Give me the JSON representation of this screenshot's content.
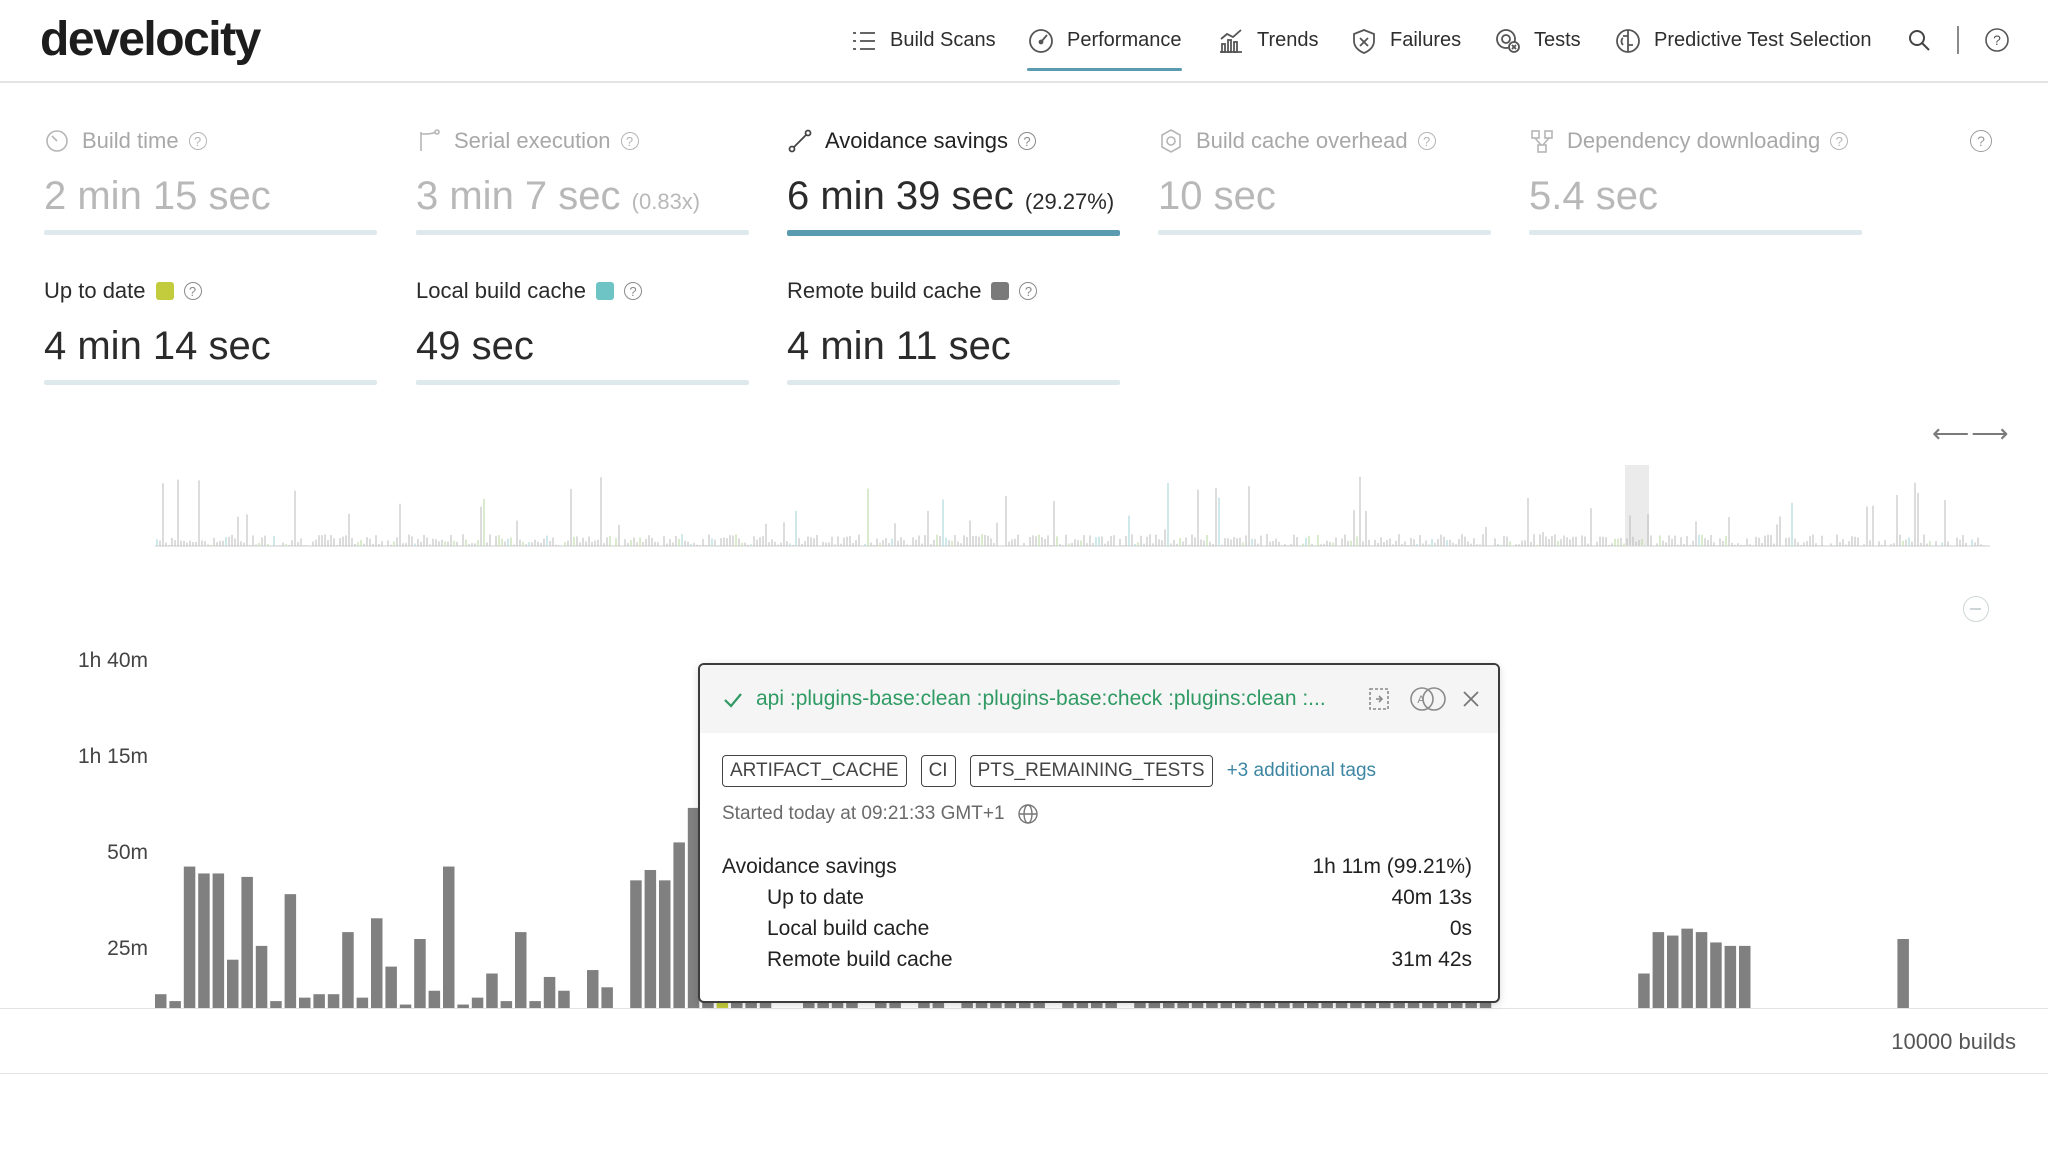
{
  "app": {
    "logo": "develocity"
  },
  "nav": {
    "items": [
      {
        "label": "Build Scans"
      },
      {
        "label": "Performance"
      },
      {
        "label": "Trends"
      },
      {
        "label": "Failures"
      },
      {
        "label": "Tests"
      },
      {
        "label": "Predictive Test Selection"
      }
    ],
    "active": "Performance",
    "accent_color": "#5a9bb0"
  },
  "metrics": {
    "row1": [
      {
        "label": "Build time",
        "value": "2 min 15 sec",
        "suffix": ""
      },
      {
        "label": "Serial execution",
        "value": "3 min 7 sec",
        "suffix": "(0.83x)"
      },
      {
        "label": "Avoidance savings",
        "value": "6 min 39 sec",
        "suffix": "(29.27%)"
      },
      {
        "label": "Build cache overhead",
        "value": "10 sec",
        "suffix": ""
      },
      {
        "label": "Dependency downloading",
        "value": "5.4 sec",
        "suffix": ""
      }
    ],
    "row2": [
      {
        "label": "Up to date",
        "value": "4 min 14 sec",
        "color": "#c3cc3c"
      },
      {
        "label": "Local build cache",
        "value": "49 sec",
        "color": "#6ec3c4"
      },
      {
        "label": "Remote build cache",
        "value": "4 min 11 sec",
        "color": "#7a7a7a"
      }
    ]
  },
  "chart_data": {
    "type": "bar",
    "y_ticks": [
      "1h 40m",
      "1h 15m",
      "50m",
      "25m"
    ],
    "ylabel": "",
    "xlabel": "",
    "ylim_minutes": [
      0,
      100
    ],
    "series_colors": {
      "default": "#808080",
      "up_to_date": "#c3cc3c",
      "not_avoided": "#e4e4e4"
    },
    "values_minutes": [
      4,
      2,
      41,
      39,
      39,
      14,
      38,
      18,
      2,
      33,
      3,
      4,
      4,
      22,
      3,
      26,
      12,
      1,
      20,
      5,
      41,
      1,
      3,
      10,
      2,
      22,
      2,
      9,
      5,
      0,
      11,
      6,
      0,
      37,
      40,
      37,
      48,
      58,
      54,
      90,
      22,
      8,
      8,
      0,
      0,
      2,
      2,
      2,
      2,
      0,
      2,
      2,
      0,
      2,
      2,
      0,
      2,
      2,
      2,
      2,
      2,
      2,
      0,
      2,
      2,
      2,
      2,
      0,
      2,
      2,
      2,
      2,
      2,
      2,
      2,
      2,
      2,
      2,
      2,
      2,
      2,
      2,
      2,
      2,
      2,
      2,
      2,
      2,
      2,
      2,
      2,
      2,
      25,
      0,
      0,
      0,
      0,
      0,
      0,
      0,
      0,
      0,
      0,
      10,
      22,
      21,
      23,
      22,
      19,
      18,
      18,
      0,
      0,
      0,
      0,
      0,
      0,
      0,
      0,
      0,
      0,
      20,
      0
    ],
    "highlight_index": 39,
    "highlight_up_to_date_minutes": 30,
    "highlight_total_minutes": 90,
    "footer_label": "10000 builds"
  },
  "popover": {
    "title": "api :plugins-base:clean :plugins-base:check :plugins:clean :...",
    "tags": [
      "ARTIFACT_CACHE",
      "CI",
      "PTS_REMAINING_TESTS"
    ],
    "more_tags": "+3 additional tags",
    "started": "Started today at 09:21:33 GMT+1",
    "rows": [
      {
        "label": "Avoidance savings",
        "value": "1h 11m (99.21%)",
        "sub": false
      },
      {
        "label": "Up to date",
        "value": "40m 13s",
        "sub": true
      },
      {
        "label": "Local build cache",
        "value": "0s",
        "sub": true
      },
      {
        "label": "Remote build cache",
        "value": "31m 42s",
        "sub": true
      }
    ]
  }
}
